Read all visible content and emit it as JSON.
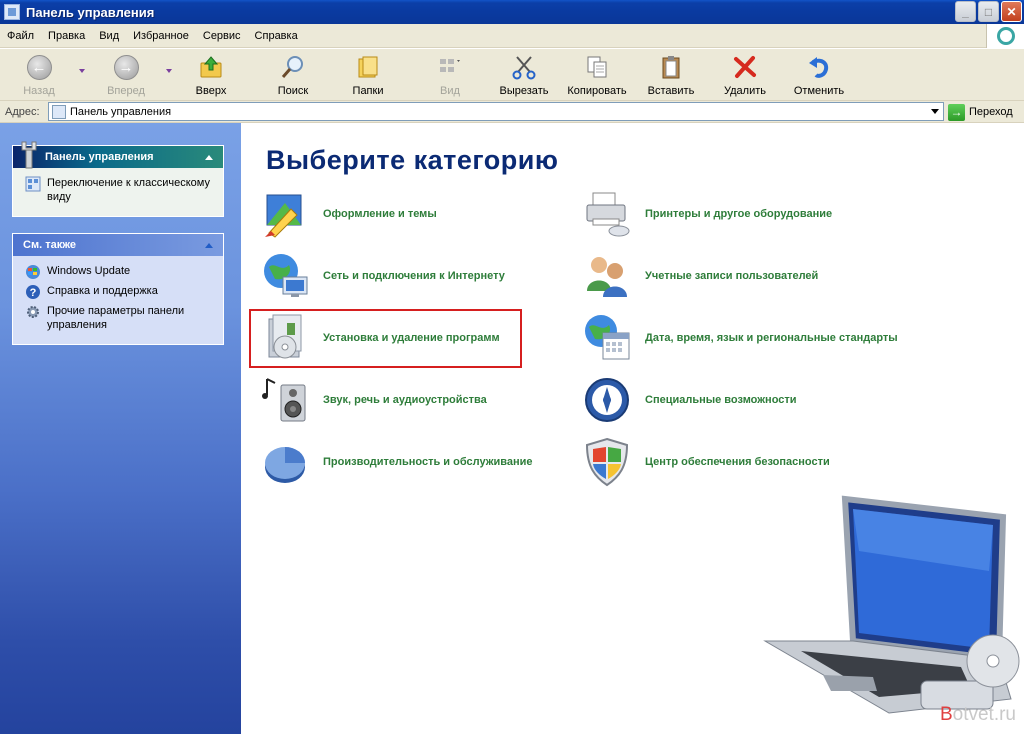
{
  "window": {
    "title": "Панель управления"
  },
  "menubar": [
    "Файл",
    "Правка",
    "Вид",
    "Избранное",
    "Сервис",
    "Справка"
  ],
  "toolbar": {
    "back": "Назад",
    "forward": "Вперед",
    "up": "Вверх",
    "search": "Поиск",
    "folders": "Папки",
    "view": "Вид",
    "cut": "Вырезать",
    "copy": "Копировать",
    "paste": "Вставить",
    "delete": "Удалить",
    "undo": "Отменить"
  },
  "address": {
    "label": "Адрес:",
    "value": "Панель управления",
    "go": "Переход"
  },
  "sidebar": {
    "control_panel": {
      "title": "Панель управления",
      "items": [
        "Переключение к классическому виду"
      ]
    },
    "see_also": {
      "title": "См. также",
      "items": [
        "Windows Update",
        "Справка и поддержка",
        "Прочие параметры панели управления"
      ]
    }
  },
  "main": {
    "heading": "Выберите категорию",
    "categories_left": [
      "Оформление и темы",
      "Сеть и подключения к Интернету",
      "Установка и удаление программ",
      "Звук, речь и аудиоустройства",
      "Производительность и обслуживание"
    ],
    "categories_right": [
      "Принтеры и другое оборудование",
      "Учетные записи пользователей",
      "Дата, время, язык и региональные стандарты",
      "Специальные возможности",
      "Центр обеспечения безопасности"
    ]
  },
  "watermark": {
    "first": "B",
    "rest": "otvet.ru"
  },
  "colors": {
    "category_text": "#2e7d3a",
    "heading": "#0b2a74",
    "highlight": "#d61f1f",
    "titlebar": "#0a3aa0"
  }
}
